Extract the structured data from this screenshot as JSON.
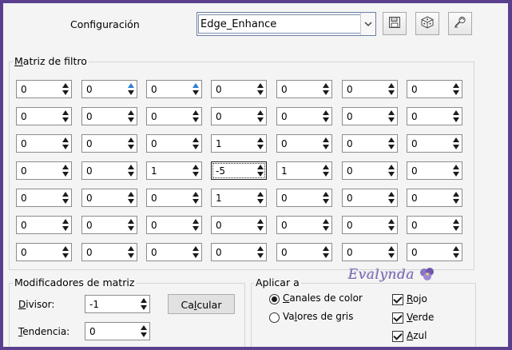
{
  "config": {
    "label": "Configuración",
    "preset_value": "Edge_Enhance",
    "icons": [
      "save-icon",
      "random-dice-icon",
      "reset-icon"
    ]
  },
  "matrix": {
    "title": "Matriz de filtro",
    "title_mnemonic": "M",
    "title_rest": "atriz de filtro",
    "rows": [
      [
        "0",
        "0",
        "0",
        "0",
        "0",
        "0",
        "0"
      ],
      [
        "0",
        "0",
        "0",
        "0",
        "0",
        "0",
        "0"
      ],
      [
        "0",
        "0",
        "0",
        "1",
        "0",
        "0",
        "0"
      ],
      [
        "0",
        "0",
        "1",
        "-5",
        "1",
        "0",
        "0"
      ],
      [
        "0",
        "0",
        "0",
        "1",
        "0",
        "0",
        "0"
      ],
      [
        "0",
        "0",
        "0",
        "0",
        "0",
        "0",
        "0"
      ],
      [
        "0",
        "0",
        "0",
        "0",
        "0",
        "0",
        "0"
      ]
    ],
    "focused_cell": "-5"
  },
  "modifiers": {
    "title": "Modificadores de matriz",
    "divisor_label_m": "D",
    "divisor_label_rest": "ivisor:",
    "divisor_value": "-1",
    "bias_label_m": "T",
    "bias_label_rest": "endencia:",
    "bias_value": "0",
    "calc_pre": "Ca",
    "calc_m": "l",
    "calc_post": "cular"
  },
  "apply": {
    "title": "Aplicar a",
    "color_m": "C",
    "color_rest": "anales de color",
    "gray_pre": "Va",
    "gray_m": "l",
    "gray_post": "ores de gris",
    "selected": "Canales de color",
    "red_m": "R",
    "red_rest": "ojo",
    "green_m": "V",
    "green_rest": "erde",
    "blue_m": "A",
    "blue_rest": "zul",
    "red_checked": true,
    "green_checked": true,
    "blue_checked": true
  },
  "watermark": "Evalynda",
  "colors": {
    "frame": "#5a3f8f",
    "background": "#f4f4f4",
    "spin_hot": "#2a7fd6"
  }
}
